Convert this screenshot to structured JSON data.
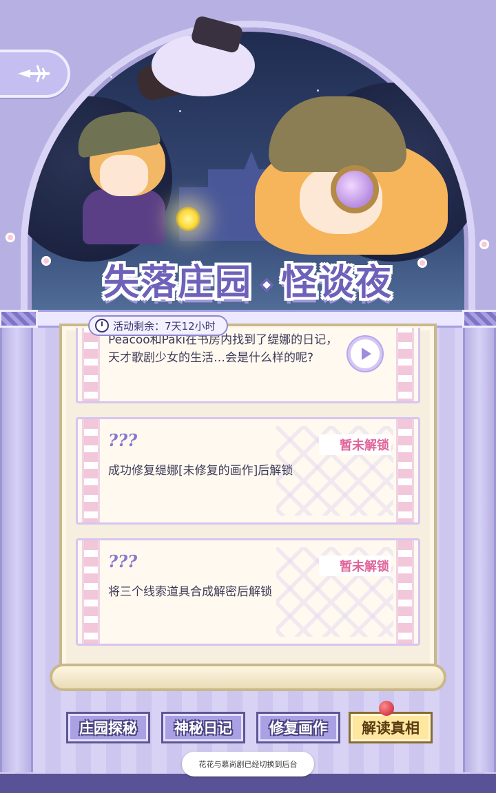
{
  "header": {
    "title_part1": "失落庄园",
    "title_part2": "怪谈夜",
    "back_icon": "compass-arrow-icon"
  },
  "timer": {
    "label": "活动剩余：7天12小时",
    "icon": "clock-icon"
  },
  "cards": [
    {
      "text": "Peacoo和Paki在书房内找到了缇娜的日记，天才歌剧少女的生活…会是什么样的呢?",
      "action_icon": "play-icon"
    },
    {
      "title": "???",
      "status": "暂未解锁",
      "text": "成功修复缇娜[未修复的画作]后解锁"
    },
    {
      "title": "???",
      "status": "暂未解锁",
      "text": "将三个线索道具合成解密后解锁"
    }
  ],
  "tabs": [
    {
      "label": "庄园探秘",
      "active": false
    },
    {
      "label": "神秘日记",
      "active": false
    },
    {
      "label": "修复画作",
      "active": false
    },
    {
      "label": "解读真相",
      "active": true
    }
  ],
  "toast": "花花与慕尚剧已经切换到后台",
  "colors": {
    "accent": "#6d62b9",
    "locked": "#e0659b",
    "paper": "#fff9ef",
    "active_tab": "#ffe7a0"
  }
}
